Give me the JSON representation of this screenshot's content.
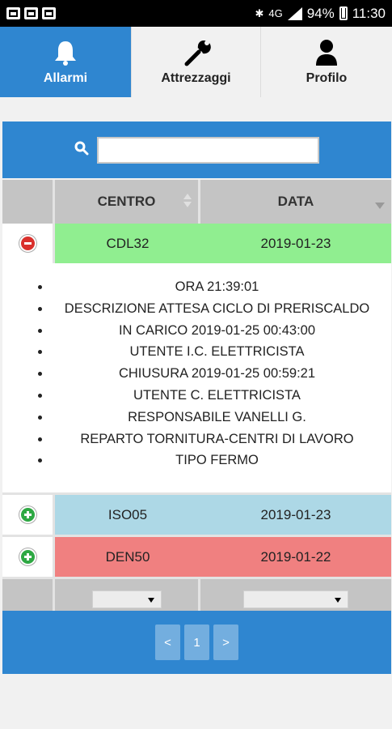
{
  "status_bar": {
    "battery": "94%",
    "time": "11:30",
    "network": "4G",
    "left_icons": [
      "notification-icon",
      "mail-icon",
      "mail-icon"
    ]
  },
  "tabs": [
    {
      "label": "Allarmi",
      "icon": "bell-icon",
      "active": true
    },
    {
      "label": "Attrezzaggi",
      "icon": "wrench-icon",
      "active": false
    },
    {
      "label": "Profilo",
      "icon": "user-icon",
      "active": false
    }
  ],
  "search": {
    "value": "",
    "icon": "search-icon"
  },
  "table": {
    "headers": {
      "centro": "CENTRO",
      "data": "DATA"
    },
    "rows": [
      {
        "centro": "CDL32",
        "data": "2019-01-23",
        "expanded": true,
        "color": "#90ee90"
      },
      {
        "centro": "ISO05",
        "data": "2019-01-23",
        "expanded": false,
        "color": "#add8e6"
      },
      {
        "centro": "DEN50",
        "data": "2019-01-22",
        "expanded": false,
        "color": "#f08080"
      }
    ],
    "details": [
      "ORA 21:39:01",
      "DESCRIZIONE ATTESA CICLO DI PRERISCALDO",
      "IN CARICO 2019-01-25 00:43:00",
      "UTENTE I.C. ELETTRICISTA",
      "CHIUSURA 2019-01-25 00:59:21",
      "UTENTE C. ELETTRICISTA",
      "RESPONSABILE VANELLI G.",
      "REPARTO TORNITURA-CENTRI DI LAVORO",
      "TIPO FERMO"
    ]
  },
  "pager": {
    "prev": "<",
    "page": "1",
    "next": ">"
  },
  "colors": {
    "accent": "#2f86d0",
    "header_gray": "#c4c4c4"
  }
}
